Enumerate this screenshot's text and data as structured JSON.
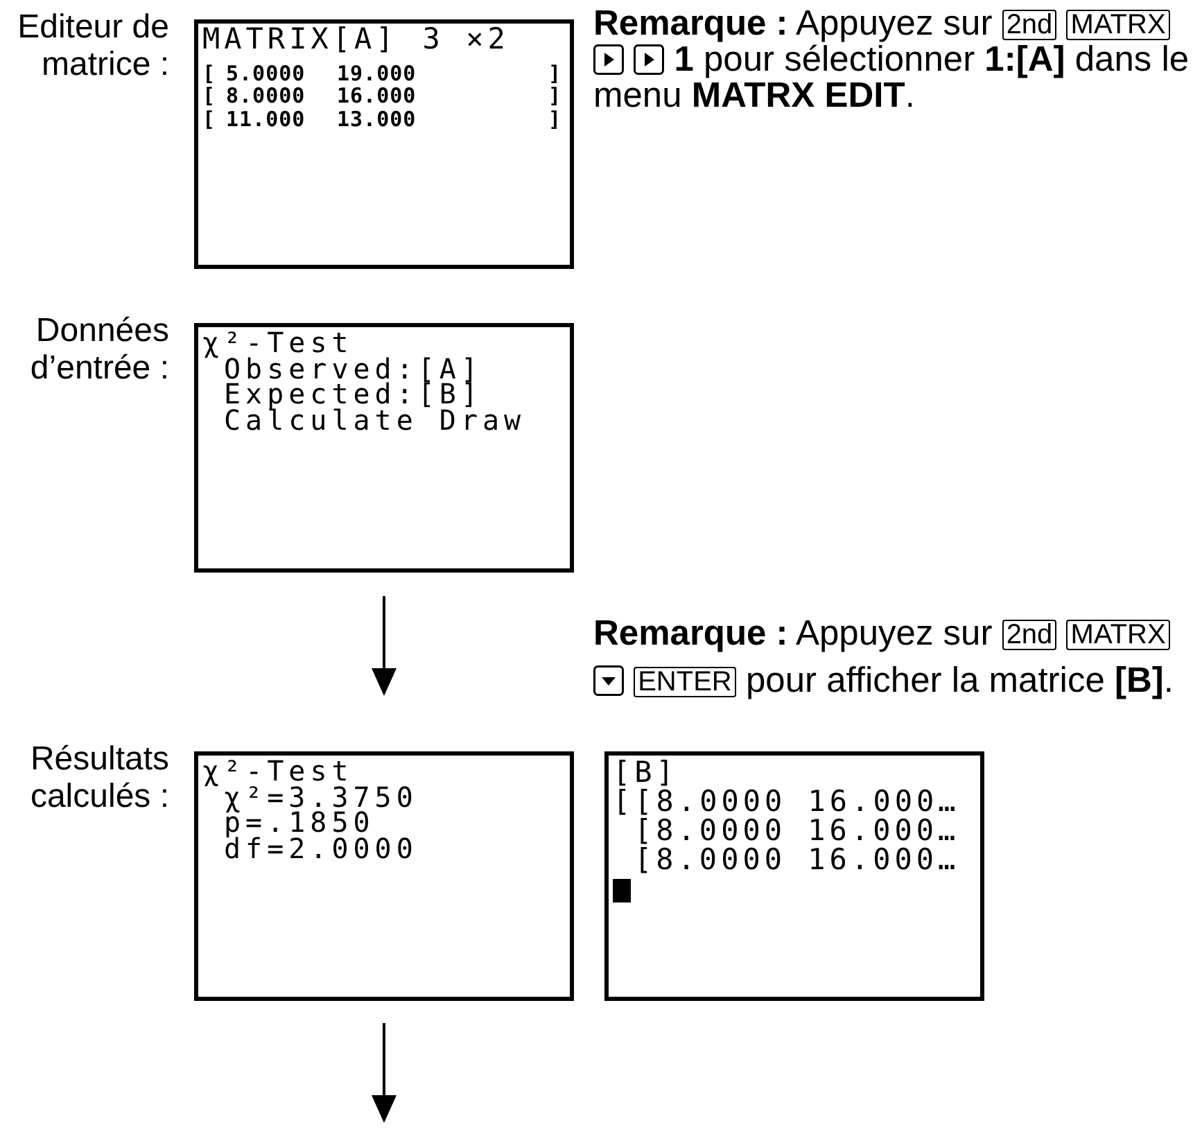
{
  "rows": [
    {
      "kind": "step",
      "label": "Editeur de matrice :",
      "screen": {
        "kind": "matrix_editor",
        "title": "MATRIX[A]",
        "dims": "3 ×2",
        "rows": [
          {
            "cells": [
              "[",
              "5.0000",
              "19.000",
              "]"
            ]
          },
          {
            "cells": [
              "[",
              "8.0000",
              "16.000",
              "]"
            ]
          },
          {
            "cells": [
              "[",
              "11.000",
              "13.000",
              "]"
            ]
          }
        ]
      },
      "note": {
        "parts": [
          {
            "kind": "text",
            "text": "**Remarque :** Appuyez sur"
          },
          {
            "kind": "key",
            "text": "2nd"
          },
          {
            "kind": "key",
            "text": "MATRX"
          },
          {
            "kind": "right_key"
          },
          {
            "kind": "right_key"
          },
          {
            "kind": "text",
            "text": "**1** pour sélectionner **1:[A]** dans le menu **MATRX EDIT**."
          }
        ]
      }
    },
    {
      "kind": "step",
      "label": "Données d’entrée :",
      "screen": {
        "kind": "lines",
        "lines": [
          {
            "text": "χ²-Test",
            "indented": false
          },
          {
            "text": "Observed:[A]",
            "indented": true
          },
          {
            "text": "Expected:[B]",
            "indented": true
          },
          {
            "text": "Calculate Draw",
            "indented": true
          }
        ]
      }
    },
    {
      "kind": "connector",
      "note": {
        "parts": [
          {
            "kind": "text",
            "text": "**Remarque :** Appuyez sur"
          },
          {
            "kind": "key",
            "text": "2nd"
          },
          {
            "kind": "key",
            "text": "MATRX"
          },
          {
            "kind": "down_key"
          },
          {
            "kind": "key",
            "text": "ENTER"
          },
          {
            "kind": "text",
            "text": "pour afficher la matrice **[B]**."
          }
        ]
      }
    },
    {
      "kind": "step",
      "label": "Résultats calculés :",
      "screen": {
        "kind": "lines",
        "lines": [
          {
            "text": "χ²-Test",
            "indented": false
          },
          {
            "text": "χ²=3.3750",
            "indented": true
          },
          {
            "text": "p=.1850",
            "indented": true
          },
          {
            "text": "df=2.0000",
            "indented": true
          }
        ]
      },
      "side_screen": {
        "kind": "lines",
        "lines": [
          {
            "text": "[B]",
            "indented": false
          },
          {
            "text": "[[8.0000 16.000…",
            "indented": false
          },
          {
            "text": "[8.0000 16.000…",
            "indented": true
          },
          {
            "text": "[8.0000 16.000…",
            "indented": true
          }
        ],
        "cursor": true
      }
    },
    {
      "kind": "connector"
    }
  ]
}
